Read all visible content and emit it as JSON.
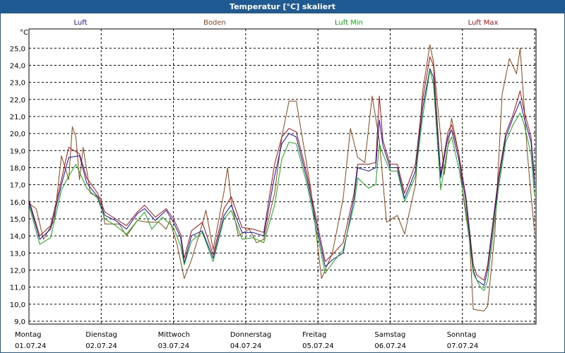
{
  "window": {
    "title": "Temperatur [°C] skaliert"
  },
  "colors": {
    "frame": "#1f5a92",
    "grid": "#000000"
  },
  "chart_data": {
    "type": "line",
    "title": "Temperatur [°C] skaliert",
    "ylabel": "°C",
    "ylim": [
      9.0,
      25.0
    ],
    "y_ticks": [
      "25,0",
      "24,0",
      "23,0",
      "22,0",
      "21,0",
      "20,0",
      "19,0",
      "18,0",
      "17,0",
      "16,0",
      "15,0",
      "14,0",
      "13,0",
      "12,0",
      "11,0",
      "10,0",
      "9,0"
    ],
    "x_range": [
      0,
      7
    ],
    "x_tick_days": [
      "Montag",
      "Dienstag",
      "Mittwoch",
      "Donnerstag",
      "Freitag",
      "Samstag",
      "Sonntag"
    ],
    "x_tick_dates": [
      "01.07.24",
      "02.07.24",
      "03.07.24",
      "04.07.24",
      "05.07.24",
      "06.07.24",
      "07.07.24"
    ],
    "grid": true,
    "legend_position": "top",
    "series": [
      {
        "name": "Luft",
        "color": "#1010b0",
        "points": [
          [
            0.0,
            16.0
          ],
          [
            0.15,
            13.8
          ],
          [
            0.3,
            14.4
          ],
          [
            0.45,
            17.0
          ],
          [
            0.55,
            18.6
          ],
          [
            0.7,
            18.7
          ],
          [
            0.8,
            17.1
          ],
          [
            0.95,
            16.3
          ],
          [
            1.05,
            15.2
          ],
          [
            1.2,
            14.9
          ],
          [
            1.35,
            14.4
          ],
          [
            1.5,
            15.3
          ],
          [
            1.6,
            15.6
          ],
          [
            1.75,
            14.9
          ],
          [
            1.9,
            15.5
          ],
          [
            2.0,
            14.8
          ],
          [
            2.1,
            13.9
          ],
          [
            2.15,
            12.4
          ],
          [
            2.25,
            14.0
          ],
          [
            2.4,
            14.3
          ],
          [
            2.55,
            12.7
          ],
          [
            2.7,
            15.2
          ],
          [
            2.8,
            15.8
          ],
          [
            2.95,
            14.2
          ],
          [
            3.1,
            14.2
          ],
          [
            3.25,
            14.0
          ],
          [
            3.4,
            17.5
          ],
          [
            3.5,
            19.4
          ],
          [
            3.6,
            20.0
          ],
          [
            3.7,
            19.8
          ],
          [
            3.85,
            17.3
          ],
          [
            4.1,
            12.2
          ],
          [
            4.2,
            12.6
          ],
          [
            4.35,
            13.0
          ],
          [
            4.5,
            16.2
          ],
          [
            4.55,
            18.0
          ],
          [
            4.7,
            17.8
          ],
          [
            4.8,
            18.0
          ],
          [
            4.85,
            20.8
          ],
          [
            4.9,
            19.3
          ],
          [
            5.0,
            18.0
          ],
          [
            5.1,
            18.0
          ],
          [
            5.2,
            16.2
          ],
          [
            5.35,
            17.8
          ],
          [
            5.45,
            21.5
          ],
          [
            5.55,
            23.8
          ],
          [
            5.6,
            23.3
          ],
          [
            5.7,
            17.4
          ],
          [
            5.8,
            19.8
          ],
          [
            5.85,
            20.2
          ],
          [
            5.95,
            18.5
          ],
          [
            6.05,
            16.0
          ],
          [
            6.15,
            12.0
          ],
          [
            6.2,
            11.4
          ],
          [
            6.3,
            11.1
          ],
          [
            6.35,
            12.0
          ],
          [
            6.5,
            17.2
          ],
          [
            6.6,
            19.8
          ],
          [
            6.7,
            20.9
          ],
          [
            6.8,
            21.9
          ],
          [
            6.85,
            21.0
          ],
          [
            6.95,
            19.5
          ],
          [
            7.0,
            17.0
          ]
        ]
      },
      {
        "name": "Boden",
        "color": "#8b4513",
        "points": [
          [
            0.0,
            15.9
          ],
          [
            0.1,
            15.6
          ],
          [
            0.2,
            13.8
          ],
          [
            0.35,
            14.9
          ],
          [
            0.45,
            18.7
          ],
          [
            0.55,
            17.3
          ],
          [
            0.6,
            20.4
          ],
          [
            0.65,
            19.8
          ],
          [
            0.7,
            17.3
          ],
          [
            0.75,
            19.2
          ],
          [
            0.85,
            16.5
          ],
          [
            1.0,
            16.2
          ],
          [
            1.05,
            14.7
          ],
          [
            1.15,
            14.7
          ],
          [
            1.25,
            14.7
          ],
          [
            1.35,
            14.0
          ],
          [
            1.5,
            14.9
          ],
          [
            1.65,
            14.8
          ],
          [
            1.8,
            14.8
          ],
          [
            1.9,
            14.4
          ],
          [
            1.95,
            14.9
          ],
          [
            2.05,
            13.5
          ],
          [
            2.15,
            11.5
          ],
          [
            2.25,
            12.6
          ],
          [
            2.35,
            14.0
          ],
          [
            2.4,
            14.7
          ],
          [
            2.45,
            15.5
          ],
          [
            2.55,
            13.2
          ],
          [
            2.7,
            16.6
          ],
          [
            2.75,
            18.0
          ],
          [
            2.8,
            16.0
          ],
          [
            2.9,
            14.0
          ],
          [
            3.05,
            14.4
          ],
          [
            3.15,
            13.6
          ],
          [
            3.25,
            13.8
          ],
          [
            3.4,
            16.5
          ],
          [
            3.5,
            19.8
          ],
          [
            3.6,
            21.9
          ],
          [
            3.7,
            21.9
          ],
          [
            3.9,
            16.8
          ],
          [
            4.05,
            11.5
          ],
          [
            4.2,
            13.0
          ],
          [
            4.35,
            16.2
          ],
          [
            4.45,
            20.3
          ],
          [
            4.55,
            18.6
          ],
          [
            4.65,
            18.3
          ],
          [
            4.75,
            22.2
          ],
          [
            4.85,
            19.6
          ],
          [
            4.95,
            14.8
          ],
          [
            5.1,
            15.2
          ],
          [
            5.2,
            14.1
          ],
          [
            5.35,
            17.0
          ],
          [
            5.45,
            22.5
          ],
          [
            5.55,
            25.2
          ],
          [
            5.6,
            24.2
          ],
          [
            5.75,
            17.6
          ],
          [
            5.85,
            20.9
          ],
          [
            5.95,
            18.8
          ],
          [
            6.0,
            16.7
          ],
          [
            6.1,
            13.7
          ],
          [
            6.15,
            9.7
          ],
          [
            6.3,
            9.6
          ],
          [
            6.35,
            9.9
          ],
          [
            6.45,
            14.2
          ],
          [
            6.55,
            22.3
          ],
          [
            6.65,
            24.4
          ],
          [
            6.75,
            23.5
          ],
          [
            6.8,
            25.0
          ],
          [
            6.9,
            18.8
          ],
          [
            6.95,
            16.4
          ],
          [
            7.0,
            14.2
          ]
        ]
      },
      {
        "name": "Luft Min",
        "color": "#10b010",
        "points": [
          [
            0.0,
            15.8
          ],
          [
            0.15,
            13.5
          ],
          [
            0.3,
            13.9
          ],
          [
            0.45,
            16.7
          ],
          [
            0.55,
            17.5
          ],
          [
            0.65,
            18.2
          ],
          [
            0.8,
            16.8
          ],
          [
            0.95,
            16.2
          ],
          [
            1.05,
            15.0
          ],
          [
            1.2,
            14.6
          ],
          [
            1.35,
            14.1
          ],
          [
            1.5,
            14.9
          ],
          [
            1.6,
            15.4
          ],
          [
            1.7,
            14.4
          ],
          [
            1.85,
            15.1
          ],
          [
            2.0,
            14.5
          ],
          [
            2.1,
            13.4
          ],
          [
            2.15,
            12.3
          ],
          [
            2.25,
            13.7
          ],
          [
            2.4,
            14.2
          ],
          [
            2.55,
            12.5
          ],
          [
            2.7,
            15.0
          ],
          [
            2.8,
            15.5
          ],
          [
            2.95,
            13.8
          ],
          [
            3.1,
            13.9
          ],
          [
            3.25,
            13.6
          ],
          [
            3.4,
            15.8
          ],
          [
            3.5,
            18.5
          ],
          [
            3.6,
            19.5
          ],
          [
            3.7,
            19.4
          ],
          [
            3.85,
            17.0
          ],
          [
            4.1,
            11.8
          ],
          [
            4.2,
            12.4
          ],
          [
            4.35,
            13.2
          ],
          [
            4.5,
            15.8
          ],
          [
            4.55,
            17.4
          ],
          [
            4.7,
            16.8
          ],
          [
            4.8,
            17.0
          ],
          [
            4.85,
            19.4
          ],
          [
            4.9,
            18.8
          ],
          [
            5.0,
            17.8
          ],
          [
            5.1,
            17.8
          ],
          [
            5.2,
            16.0
          ],
          [
            5.35,
            17.5
          ],
          [
            5.45,
            21.0
          ],
          [
            5.55,
            23.7
          ],
          [
            5.6,
            22.9
          ],
          [
            5.7,
            16.7
          ],
          [
            5.8,
            19.3
          ],
          [
            5.85,
            19.8
          ],
          [
            5.95,
            18.0
          ],
          [
            6.05,
            15.5
          ],
          [
            6.15,
            11.8
          ],
          [
            6.25,
            11.0
          ],
          [
            6.3,
            10.8
          ],
          [
            6.35,
            11.4
          ],
          [
            6.5,
            16.8
          ],
          [
            6.6,
            19.5
          ],
          [
            6.7,
            20.5
          ],
          [
            6.8,
            21.2
          ],
          [
            6.85,
            20.6
          ],
          [
            6.95,
            18.8
          ],
          [
            7.0,
            16.3
          ]
        ]
      },
      {
        "name": "Luft Max",
        "color": "#b01010",
        "points": [
          [
            0.0,
            16.1
          ],
          [
            0.15,
            14.0
          ],
          [
            0.3,
            14.6
          ],
          [
            0.45,
            17.3
          ],
          [
            0.55,
            19.2
          ],
          [
            0.7,
            18.8
          ],
          [
            0.8,
            17.4
          ],
          [
            0.95,
            16.5
          ],
          [
            1.05,
            15.4
          ],
          [
            1.2,
            15.0
          ],
          [
            1.35,
            14.6
          ],
          [
            1.5,
            15.4
          ],
          [
            1.6,
            15.8
          ],
          [
            1.75,
            15.1
          ],
          [
            1.9,
            15.6
          ],
          [
            2.0,
            15.0
          ],
          [
            2.1,
            14.1
          ],
          [
            2.15,
            12.7
          ],
          [
            2.25,
            14.3
          ],
          [
            2.4,
            14.8
          ],
          [
            2.55,
            12.9
          ],
          [
            2.7,
            15.6
          ],
          [
            2.8,
            16.3
          ],
          [
            2.95,
            14.5
          ],
          [
            3.1,
            14.4
          ],
          [
            3.25,
            14.2
          ],
          [
            3.4,
            18.2
          ],
          [
            3.5,
            19.8
          ],
          [
            3.6,
            20.3
          ],
          [
            3.7,
            20.1
          ],
          [
            3.85,
            17.6
          ],
          [
            4.1,
            12.5
          ],
          [
            4.2,
            12.9
          ],
          [
            4.35,
            13.6
          ],
          [
            4.5,
            16.5
          ],
          [
            4.55,
            18.2
          ],
          [
            4.7,
            18.2
          ],
          [
            4.8,
            18.3
          ],
          [
            4.85,
            22.2
          ],
          [
            4.9,
            19.6
          ],
          [
            5.0,
            18.2
          ],
          [
            5.1,
            18.2
          ],
          [
            5.2,
            16.5
          ],
          [
            5.35,
            18.2
          ],
          [
            5.45,
            22.0
          ],
          [
            5.55,
            24.5
          ],
          [
            5.6,
            24.0
          ],
          [
            5.7,
            17.6
          ],
          [
            5.8,
            20.1
          ],
          [
            5.85,
            20.5
          ],
          [
            5.95,
            18.8
          ],
          [
            6.05,
            16.3
          ],
          [
            6.15,
            12.3
          ],
          [
            6.2,
            11.7
          ],
          [
            6.3,
            11.4
          ],
          [
            6.35,
            12.3
          ],
          [
            6.5,
            17.5
          ],
          [
            6.6,
            20.0
          ],
          [
            6.7,
            21.1
          ],
          [
            6.8,
            22.5
          ],
          [
            6.85,
            21.4
          ],
          [
            6.95,
            19.8
          ],
          [
            7.0,
            17.3
          ]
        ]
      }
    ]
  }
}
